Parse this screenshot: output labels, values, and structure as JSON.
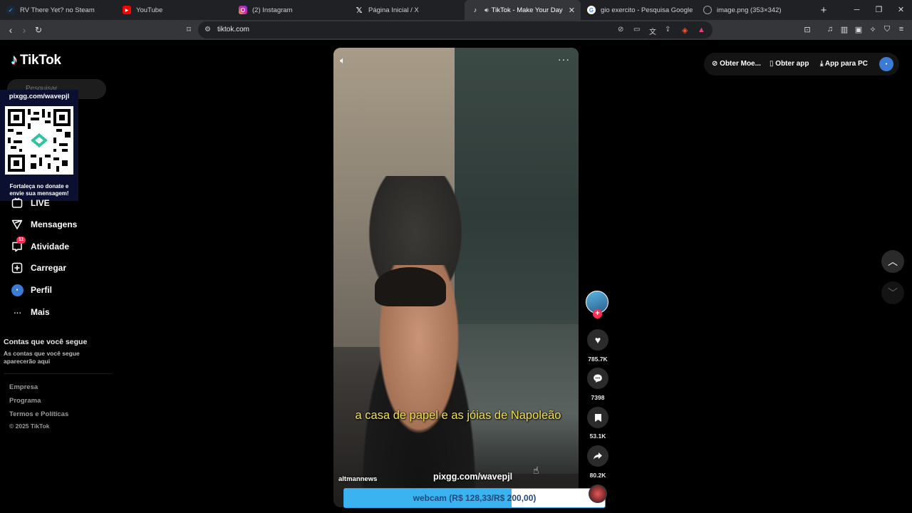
{
  "browser": {
    "tabs": [
      {
        "title": "RV There Yet? no Steam",
        "icon": "steam-icon",
        "icon_color": "#1b2838"
      },
      {
        "title": "YouTube",
        "icon": "youtube-icon",
        "icon_color": "#ff0000"
      },
      {
        "title": "(2) Instagram",
        "icon": "instagram-icon",
        "icon_color": "#d6249f"
      },
      {
        "title": "Página Inicial / X",
        "icon": "x-icon",
        "icon_color": "#000000"
      },
      {
        "title": "TikTok - Make Your Day",
        "icon": "tiktok-icon",
        "icon_color": "#000000",
        "active": true
      },
      {
        "title": "gio exercito - Pesquisa Google",
        "icon": "google-icon",
        "icon_color": "#4285f4"
      },
      {
        "title": "image.png (353×342)",
        "icon": "globe-icon",
        "icon_color": "#9aa0a6"
      }
    ],
    "url": "tiktok.com"
  },
  "sidebar": {
    "logo_text": "TikTok",
    "search_placeholder": "Pesquisar",
    "items": [
      {
        "label": "LIVE",
        "icon": "live-icon"
      },
      {
        "label": "Mensagens",
        "icon": "messages-icon"
      },
      {
        "label": "Atividade",
        "icon": "activity-icon",
        "badge": "11"
      },
      {
        "label": "Carregar",
        "icon": "upload-icon"
      },
      {
        "label": "Perfil",
        "icon": "profile-avatar"
      },
      {
        "label": "Mais",
        "icon": "more-icon"
      }
    ],
    "following_title": "Contas que você segue",
    "following_subtitle": "As contas que você segue aparecerão aqui",
    "footer_links": [
      "Empresa",
      "Programa",
      "Termos e Políticas"
    ],
    "copyright": "© 2025 TikTok"
  },
  "overlay": {
    "qr_url": "pixgg.com/wavepjl",
    "qr_caption": "Fortaleça no donate e envie sua mensagem!"
  },
  "video": {
    "caption": "a casa de papel e as jóias de Napoleão",
    "watermark": "pixgg.com/wavepjl",
    "author_watermark": "altmannews",
    "goal_text": "webcam (R$ 128,33/R$ 200,00)",
    "goal_progress": 0.6417
  },
  "actions": {
    "likes": "785.7K",
    "comments": "7398",
    "saves": "53.1K",
    "shares": "80.2K"
  },
  "top_right": {
    "coins": "Obter Moe...",
    "app": "Obter app",
    "pc_app": "App para PC"
  },
  "colors": {
    "accent": "#fe2c55",
    "caption": "#f3e24a",
    "goal_fill": "#3ab3f0"
  }
}
